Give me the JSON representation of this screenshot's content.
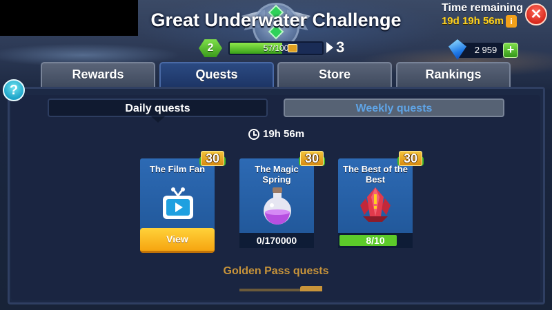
{
  "header": {
    "title": "Great Underwater Challenge",
    "time_label": "Time remaining",
    "time_value": "19d 19h 56m",
    "info_label": "i",
    "close_label": "✕"
  },
  "level": {
    "current": "2",
    "progress_text": "57/100",
    "progress_fraction": 0.57,
    "next": "3"
  },
  "currency": {
    "diamonds": "2 959",
    "add_label": "+"
  },
  "tabs": [
    {
      "label": "Rewards"
    },
    {
      "label": "Quests"
    },
    {
      "label": "Store"
    },
    {
      "label": "Rankings"
    }
  ],
  "help_label": "?",
  "subtabs": {
    "daily": "Daily quests",
    "weekly": "Weekly quests"
  },
  "timer": "19h 56m",
  "quests": [
    {
      "title": "The Film Fan",
      "reward": "30",
      "action": "View"
    },
    {
      "title": "The Magic Spring",
      "reward": "30",
      "progress": "0/170000",
      "progress_fraction": 0
    },
    {
      "title": "The Best of the Best",
      "reward": "30",
      "progress": "8/10",
      "progress_fraction": 0.8
    }
  ],
  "golden": {
    "title": "Golden Pass quests"
  },
  "colors": {
    "accent_green": "#5ccb2a",
    "view_button": "#f6a510",
    "card_blue": "#2d6ab4",
    "time_yellow": "#ffd21f"
  }
}
